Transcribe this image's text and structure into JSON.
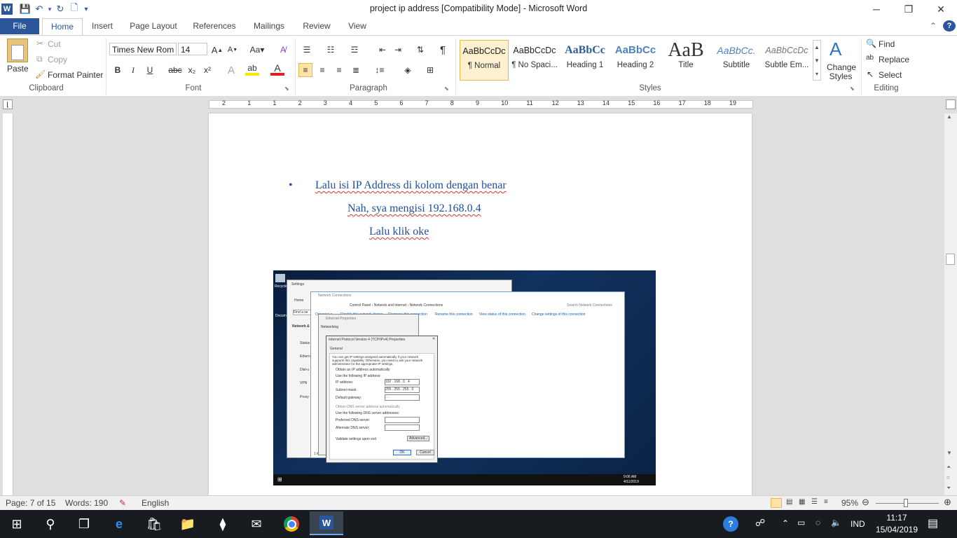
{
  "window": {
    "title": "project ip address [Compatibility Mode]  -  Microsoft Word",
    "min": "─",
    "restore": "❐",
    "close": "✕"
  },
  "qat": {
    "word_icon": "W",
    "save": "💾",
    "undo": "↶",
    "redo": "↻",
    "new": "🗋",
    "customize": "▾"
  },
  "tabs": [
    "File",
    "Home",
    "Insert",
    "Page Layout",
    "References",
    "Mailings",
    "Review",
    "View"
  ],
  "ribbon": {
    "clipboard": {
      "paste": "Paste",
      "cut": "Cut",
      "copy": "Copy",
      "format_painter": "Format Painter",
      "label": "Clipboard"
    },
    "font": {
      "name": "Times New Rom",
      "size": "14",
      "label": "Font",
      "buttons": [
        "B",
        "I",
        "U",
        "abc",
        "x₂",
        "x²"
      ]
    },
    "paragraph": {
      "label": "Paragraph",
      "pilcrow": "¶"
    },
    "styles": {
      "label": "Styles",
      "items": [
        {
          "preview": "AaBbCcDc",
          "name": "¶ Normal"
        },
        {
          "preview": "AaBbCcDc",
          "name": "¶ No Spaci..."
        },
        {
          "preview": "AaBbCc",
          "name": "Heading 1"
        },
        {
          "preview": "AaBbCc",
          "name": "Heading 2"
        },
        {
          "preview": "AaB",
          "name": "Title"
        },
        {
          "preview": "AaBbCc.",
          "name": "Subtitle"
        },
        {
          "preview": "AaBbCcDc",
          "name": "Subtle Em..."
        }
      ],
      "change_styles": "Change Styles"
    },
    "editing": {
      "find": "Find",
      "replace": "Replace",
      "select": "Select",
      "label": "Editing"
    }
  },
  "ruler_numbers": [
    "2",
    "1",
    "1",
    "2",
    "3",
    "4",
    "5",
    "6",
    "7",
    "8",
    "9",
    "10",
    "11",
    "12",
    "13",
    "14",
    "15",
    "16",
    "17",
    "18",
    "19"
  ],
  "document": {
    "bullet": "•",
    "line1": "Lalu isi IP Address di kolom dengan benar",
    "line2": "Nah, sya mengisi 192.168.0.4",
    "line3": "Lalu klik oke"
  },
  "screenshot": {
    "settings_title": "Settings",
    "home": "Home",
    "find": "Find a se",
    "network": "Network &",
    "side": [
      "Status",
      "Ethern",
      "Dial-u",
      "VPN",
      "Proxy"
    ],
    "recycle": "Recycle",
    "docum": "Docum",
    "netconn_title": "Network Connections",
    "address": "Control Panel  ›  Network and Internet  ›  Network Connections",
    "search_net": "Search Network Connections",
    "toolbar": [
      "Organize ▾",
      "Disable this network device",
      "Diagnose this connection",
      "Rename this connection",
      "View status of this connection",
      "Change settings of this connection"
    ],
    "eth_title": "Ethernet Properties",
    "networking": "Networking",
    "item_count": "1 item",
    "ipv4_title": "Internet Protocol Version 4 (TCP/IPv4) Properties",
    "general": "General",
    "desc": "You can get IP settings assigned automatically if your network supports this capability. Otherwise, you need to ask your network administrator for the appropriate IP settings.",
    "obtain_auto": "Obtain an IP address automatically",
    "use_following": "Use the following IP address:",
    "ip_label": "IP address:",
    "ip_value": "192 . 168 .  0  .  4",
    "mask_label": "Subnet mask:",
    "mask_value": "255 . 255 . 255 .  0",
    "gw_label": "Default gateway:",
    "gw_value": " .      .      . ",
    "dns_auto": "Obtain DNS server address automatically",
    "dns_use": "Use the following DNS server addresses:",
    "pref_dns": "Preferred DNS server:",
    "alt_dns": "Alternate DNS server:",
    "validate": "Validate settings upon exit",
    "advanced": "Advanced...",
    "ok": "OK",
    "cancel": "Cancel",
    "clock_time": "9:06 AM",
    "clock_date": "4/11/2019"
  },
  "status": {
    "page": "Page: 7 of 15",
    "words": "Words: 190",
    "lang": "English",
    "zoom": "95%"
  },
  "taskbar": {
    "lang": "IND",
    "time": "11:17",
    "date": "15/04/2019"
  }
}
